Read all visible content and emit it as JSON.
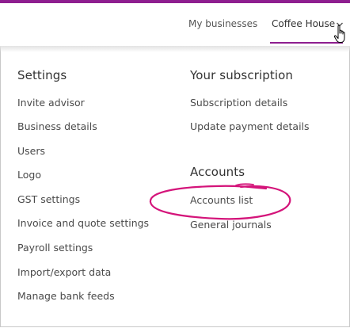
{
  "header": {
    "nav": [
      {
        "label": "My businesses"
      },
      {
        "label": "Coffee House"
      }
    ]
  },
  "settings": {
    "title": "Settings",
    "items": [
      {
        "label": "Invite advisor"
      },
      {
        "label": "Business details"
      },
      {
        "label": "Users"
      },
      {
        "label": "Logo"
      },
      {
        "label": "GST settings"
      },
      {
        "label": "Invoice and quote settings"
      },
      {
        "label": "Payroll settings"
      },
      {
        "label": "Import/export data"
      },
      {
        "label": "Manage bank feeds"
      }
    ]
  },
  "subscription": {
    "title": "Your subscription",
    "items": [
      {
        "label": "Subscription details"
      },
      {
        "label": "Update payment details"
      }
    ]
  },
  "accounts": {
    "title": "Accounts",
    "items": [
      {
        "label": "Accounts list"
      },
      {
        "label": "General journals"
      }
    ]
  },
  "colors": {
    "brand": "#8e1e8f",
    "highlight_ring": "#d4147a"
  },
  "icons": {
    "dropdown": "chevron-down-icon",
    "cursor": "hand-cursor-icon"
  }
}
